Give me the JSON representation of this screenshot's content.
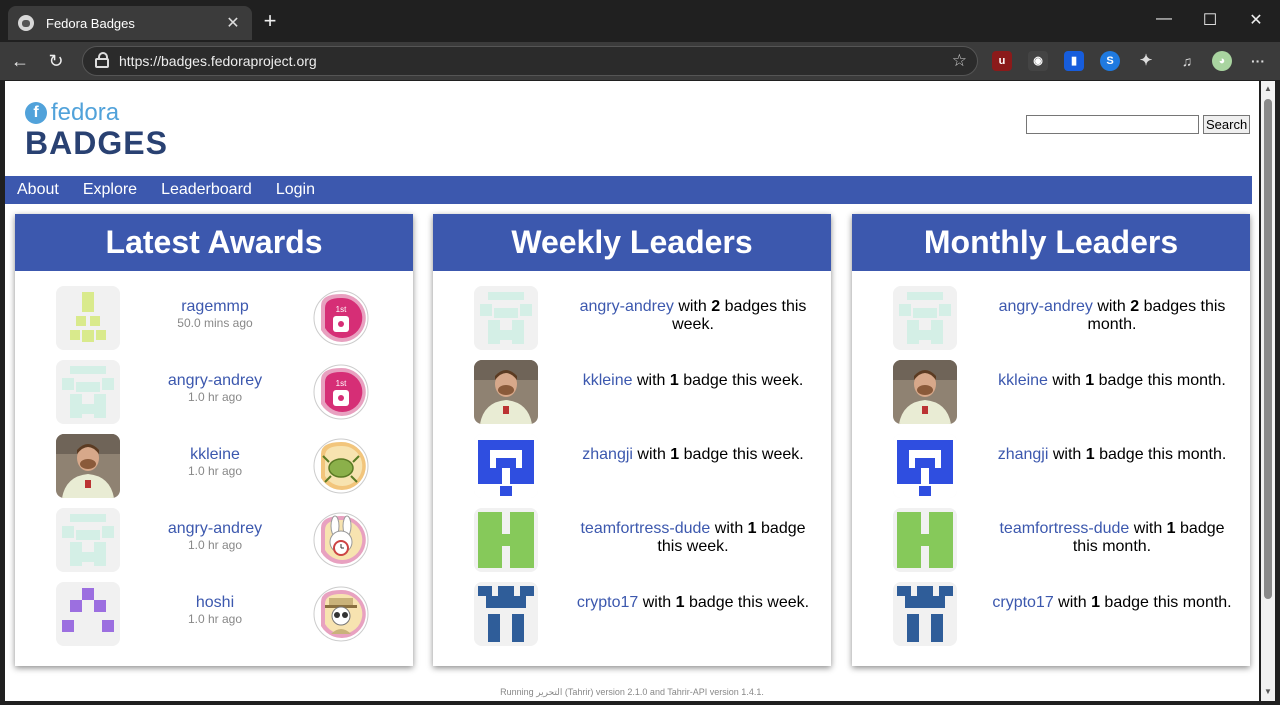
{
  "browser": {
    "tab_title": "Fedora Badges",
    "url": "https://badges.fedoraproject.org"
  },
  "site": {
    "logo_top": "fedora",
    "logo_bottom": "BADGES",
    "search_button": "Search",
    "nav": [
      "About",
      "Explore",
      "Leaderboard",
      "Login"
    ]
  },
  "latest": {
    "title": "Latest Awards",
    "items": [
      {
        "user": "ragemmp",
        "time": "50.0 mins ago",
        "avatar": "identicon-yellow",
        "badge": "badge-pink-1st"
      },
      {
        "user": "angry-andrey",
        "time": "1.0 hr ago",
        "avatar": "identicon-mint",
        "badge": "badge-pink-1st"
      },
      {
        "user": "kkleine",
        "time": "1.0 hr ago",
        "avatar": "photo",
        "badge": "badge-orange-bug"
      },
      {
        "user": "angry-andrey",
        "time": "1.0 hr ago",
        "avatar": "identicon-mint",
        "badge": "badge-rabbit-clock"
      },
      {
        "user": "hoshi",
        "time": "1.0 hr ago",
        "avatar": "identicon-purple",
        "badge": "badge-detective"
      }
    ]
  },
  "weekly": {
    "title": "Weekly Leaders",
    "items": [
      {
        "user": "angry-andrey",
        "mid": " with ",
        "count": "2",
        "tail": " badges this week.",
        "avatar": "identicon-mint"
      },
      {
        "user": "kkleine",
        "mid": " with ",
        "count": "1",
        "tail": " badge this week.",
        "avatar": "photo"
      },
      {
        "user": "zhangji",
        "mid": " with ",
        "count": "1",
        "tail": " badge this week.",
        "avatar": "identicon-blue"
      },
      {
        "user": "teamfortress-dude",
        "mid": " with ",
        "count": "1",
        "tail": " badge this week.",
        "avatar": "identicon-green"
      },
      {
        "user": "crypto17",
        "mid": " with ",
        "count": "1",
        "tail": " badge this week.",
        "avatar": "identicon-steel"
      }
    ]
  },
  "monthly": {
    "title": "Monthly Leaders",
    "items": [
      {
        "user": "angry-andrey",
        "mid": " with ",
        "count": "2",
        "tail": " badges this month.",
        "avatar": "identicon-mint"
      },
      {
        "user": "kkleine",
        "mid": " with ",
        "count": "1",
        "tail": " badge this month.",
        "avatar": "photo"
      },
      {
        "user": "zhangji",
        "mid": " with ",
        "count": "1",
        "tail": " badge this month.",
        "avatar": "identicon-blue"
      },
      {
        "user": "teamfortress-dude",
        "mid": " with ",
        "count": "1",
        "tail": " badge this month.",
        "avatar": "identicon-green"
      },
      {
        "user": "crypto17",
        "mid": " with ",
        "count": "1",
        "tail": " badge this month.",
        "avatar": "identicon-steel"
      }
    ]
  },
  "footer": "Running التحرير (Tahrir) version 2.1.0 and Tahrir-API version 1.4.1.",
  "colors": {
    "brand_blue": "#3c58ae",
    "identicon_yellow": "#d9ea8c",
    "identicon_mint": "#d4efe6",
    "identicon_purple": "#9c6fe0",
    "identicon_blue": "#2f4ee0",
    "identicon_green": "#86c95a",
    "identicon_steel": "#2f5d99"
  }
}
